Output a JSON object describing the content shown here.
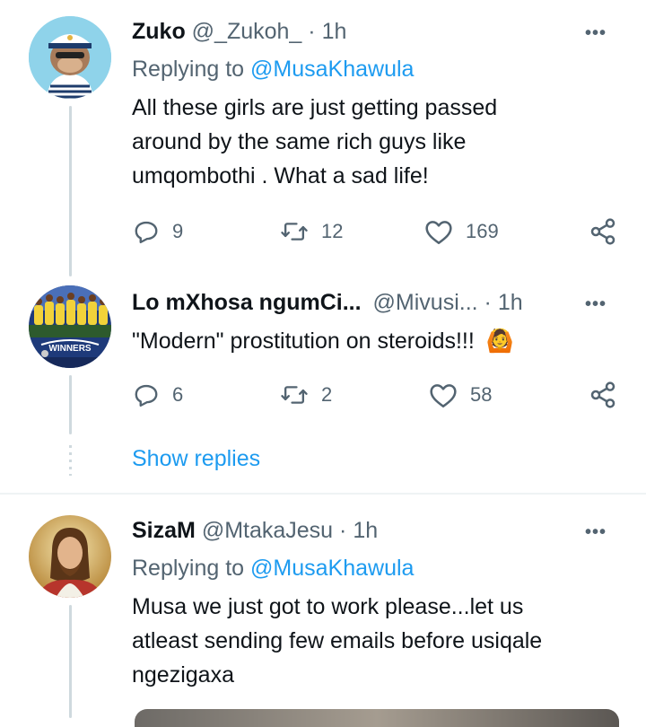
{
  "tweets": [
    {
      "name": "Zuko",
      "handle": "@_Zukoh_",
      "sep": "·",
      "time": "1h",
      "replying_prefix": "Replying to",
      "replying_handle": "@MusaKhawula",
      "lines": [
        "All these girls are just getting passed",
        "around by the same rich guys like",
        "umqombothi . What a sad life!"
      ],
      "replies": "9",
      "retweets": "12",
      "likes": "169"
    },
    {
      "name": "Lo mXhosa ngumCi...",
      "handle": "@Mivusi...",
      "sep": "·",
      "time": "1h",
      "text": "\"Modern\" prostitution on steroids!!!",
      "emoji": "🙆",
      "replies": "6",
      "retweets": "2",
      "likes": "58"
    },
    {
      "name": "SizaM",
      "handle": "@MtakaJesu",
      "sep": "·",
      "time": "1h",
      "replying_prefix": "Replying to",
      "replying_handle": "@MusaKhawula",
      "lines": [
        "Musa we just got to work please...let us",
        "atleast sending few emails before usiqale",
        "ngezigaxa"
      ]
    }
  ],
  "show_replies": "Show replies",
  "more_label": "•••",
  "icons": {
    "reply": "reply-icon",
    "retweet": "retweet-icon",
    "like": "heart-icon",
    "share": "share-icon",
    "more": "more-icon"
  },
  "colors": {
    "link": "#1d9bf0",
    "muted": "#536471",
    "thread": "#cfd9de"
  }
}
